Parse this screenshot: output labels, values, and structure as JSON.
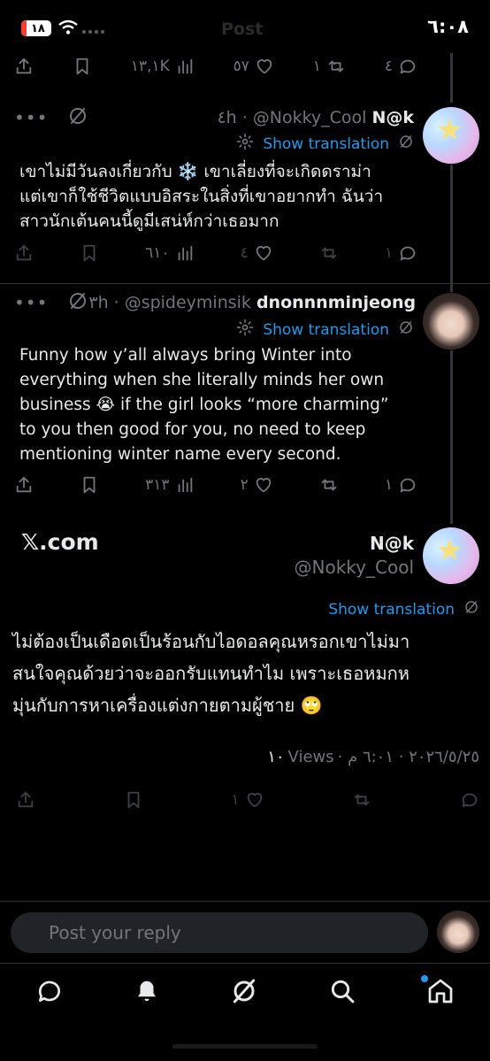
{
  "status_bar": {
    "time": "٦:٠٨",
    "battery": "١٨",
    "ghost_title": "Post"
  },
  "top_actions": {
    "views": "١٣,١K",
    "likes": "٥٧",
    "reposts": "١",
    "replies": "٤"
  },
  "reply1": {
    "name": "N@k",
    "handle": "@Nokky_Cool",
    "time": "٤h",
    "translate_label": "Show translation",
    "text_lines": [
      "เขาไม่มีวันลงเกี่ยวกับ ❄️ เขาเลี่ยงที่จะเกิดดราม่า",
      "แต่เขาก็ใช้ชีวิตแบบอิสระในสิ่งที่เขาอยากทำ ฉันว่า",
      "สาวนักเต้นคนนี้ดูมีเสน่ห์กว่าเธอมาก"
    ],
    "views": "٦١٠",
    "likes": "٤",
    "replies": "١"
  },
  "reply2": {
    "name": "dnonnnminjeong",
    "handle": "@spideyminsik",
    "time": "٣h",
    "translate_label": "Show translation",
    "text_lines": [
      "Funny how y’all always bring Winter into",
      "everything when she literally minds her own",
      "business 😭  if the girl looks “more charming”",
      "to you then good for you, no need to keep",
      "mentioning winter name every second."
    ],
    "views": "٣١٣",
    "likes": "٢",
    "replies": "١"
  },
  "main_post": {
    "watermark": "𝕏.com",
    "name": "N@k",
    "handle": "@Nokky_Cool",
    "translate_label": "Show translation",
    "text_lines": [
      "ไม่ต้องเป็นเดือดเป็นร้อนกับไอดอลคุณหรอกเขาไม่มา",
      "สนใจคุณด้วยว่าจะออกรับแทนทำไม เพราะเธอหมกห",
      "มุ่นกับการหาเครื่องแต่งกายตามผู้ชาย 🙄"
    ],
    "meta": "٢٠٢٦/٥/٢٥ · ٦:٠١ م · ",
    "views_count": "١٠",
    "views_label": "Views",
    "likes": "١"
  },
  "reply_bar": {
    "placeholder": "Post your reply"
  },
  "colors": {
    "accent": "#1d9bf0",
    "secondary_text": "#71767b",
    "background": "#000000"
  }
}
